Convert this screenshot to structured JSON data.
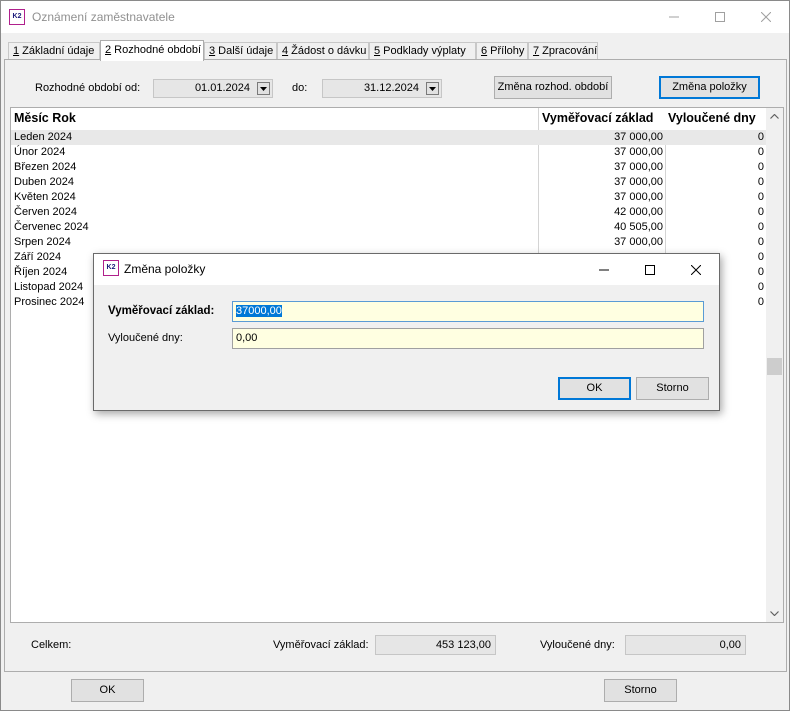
{
  "window": {
    "title": "Oznámení zaměstnavatele"
  },
  "tabs": [
    {
      "key": "1",
      "label": " Základní údaje"
    },
    {
      "key": "2",
      "label": " Rozhodné období"
    },
    {
      "key": "3",
      "label": " Další údaje"
    },
    {
      "key": "4",
      "label": " Žádost o dávku"
    },
    {
      "key": "5",
      "label": " Podklady výplaty"
    },
    {
      "key": "6",
      "label": " Přílohy"
    },
    {
      "key": "7",
      "label": " Zpracování"
    }
  ],
  "period": {
    "from_label": "Rozhodné období od:",
    "from_value": "01.01.2024",
    "to_label": "do:",
    "to_value": "31.12.2024",
    "change_period_button": "Změna rozhod. období",
    "change_item_button": "Změna položky"
  },
  "grid": {
    "columns": [
      "Měsíc Rok",
      "Vyměřovací základ",
      "Vyloučené dny"
    ],
    "rows": [
      {
        "month": "Leden 2024",
        "base": "37 000,00",
        "days": "0"
      },
      {
        "month": "Únor 2024",
        "base": "37 000,00",
        "days": "0"
      },
      {
        "month": "Březen 2024",
        "base": "37 000,00",
        "days": "0"
      },
      {
        "month": "Duben 2024",
        "base": "37 000,00",
        "days": "0"
      },
      {
        "month": "Květen 2024",
        "base": "37 000,00",
        "days": "0"
      },
      {
        "month": "Červen 2024",
        "base": "42 000,00",
        "days": "0"
      },
      {
        "month": "Červenec 2024",
        "base": "40 505,00",
        "days": "0"
      },
      {
        "month": "Srpen 2024",
        "base": "37 000,00",
        "days": "0"
      },
      {
        "month": "Září 2024",
        "base": "",
        "days": "0"
      },
      {
        "month": "Říjen 2024",
        "base": "",
        "days": "0"
      },
      {
        "month": "Listopad 2024",
        "base": "",
        "days": "0"
      },
      {
        "month": "Prosinec 2024",
        "base": "",
        "days": "0"
      }
    ]
  },
  "summary": {
    "total_label": "Celkem:",
    "base_label": "Vyměřovací základ:",
    "base_value": "453 123,00",
    "days_label": "Vyloučené dny:",
    "days_value": "0,00"
  },
  "footer": {
    "ok_label": "OK",
    "cancel_label": "Storno"
  },
  "dialog": {
    "title": "Změna položky",
    "base_label": "Vyměřovací základ:",
    "base_value": "37000,00",
    "days_label": "Vyloučené dny:",
    "days_value": "0,00",
    "ok_label": "OK",
    "cancel_label": "Storno"
  },
  "icons": {
    "app": "K2"
  }
}
